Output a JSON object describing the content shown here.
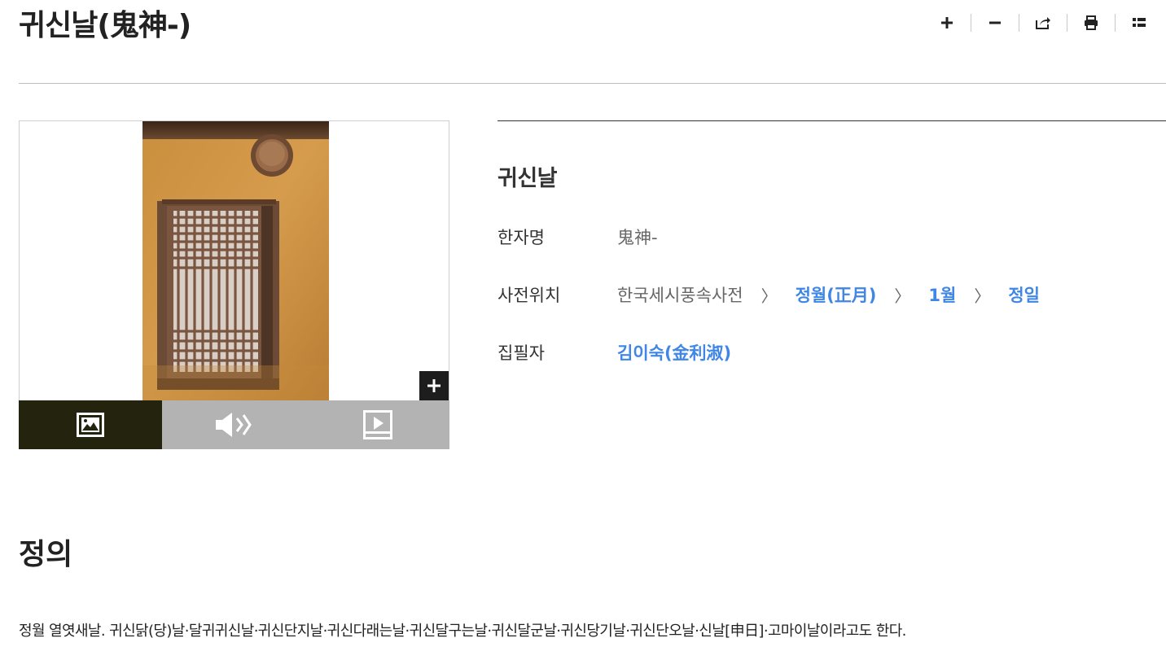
{
  "page": {
    "title": "귀신날(鬼神-)"
  },
  "toolbar": {
    "items": [
      {
        "icon": "zoom-in-icon"
      },
      {
        "icon": "zoom-out-icon"
      },
      {
        "icon": "share-icon"
      },
      {
        "icon": "print-icon"
      },
      {
        "icon": "toc-icon"
      }
    ]
  },
  "media": {
    "tabs": [
      {
        "icon": "image-icon",
        "active": true
      },
      {
        "icon": "audio-icon",
        "active": false
      },
      {
        "icon": "video-icon",
        "active": false
      }
    ],
    "zoom_symbol": "+"
  },
  "info": {
    "heading": "귀신날",
    "hanja_label": "한자명",
    "hanja_value": "鬼神-",
    "location_label": "사전위치",
    "location_path": [
      "한국세시풍속사전",
      "정월(正月)",
      "1월",
      "정일"
    ],
    "author_label": "집필자",
    "author": "김이숙(金利淑)"
  },
  "colors": {
    "link": "#3f86e6",
    "active_tab": "#24230e",
    "inactive_tab": "#b3b3b3"
  },
  "definition": {
    "section_title": "정의",
    "text": "정월 열엿새날. 귀신닭(당)날·달귀귀신날·귀신단지날·귀신다래는날·귀신달구는날·귀신달군날·귀신당기날·귀신단오날·신날[申日]·고마이날이라고도 한다."
  }
}
